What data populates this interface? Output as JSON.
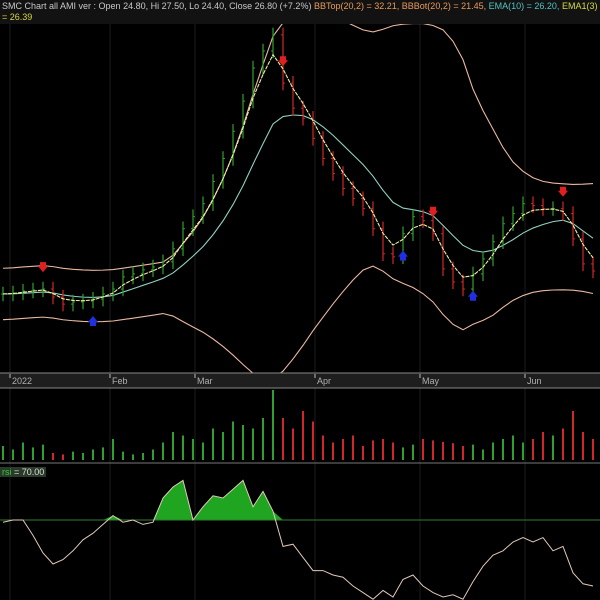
{
  "header": {
    "title": "SMC Chart all AMI ver :",
    "ohlc": "Open 24.80, Hi 27.50, Lo 24.40, Close 26.80 (+7.2%)",
    "bbtop": "BBTop(20,2) = 32.21,",
    "bbbot": "BBBot(20,2) = 21.45,",
    "ema10": "EMA(10) = 26.20,",
    "ema3": "EMA1(3) = 26.39"
  },
  "rsi_label": {
    "name": "rsi",
    "value": "= 70.00"
  },
  "colors": {
    "up": "#2fa02f",
    "down": "#d02828",
    "band": "#e8b8a0",
    "ema10": "#8fd0c0",
    "ema3": "#f0f0a0",
    "fill": "#1fa51f"
  },
  "chart_data": {
    "type": "candlestick",
    "x_tick_labels": [
      "2022",
      "Feb",
      "Mar",
      "Apr",
      "May",
      "Jun"
    ],
    "close": [
      24.93,
      24.99,
      25.11,
      25.18,
      25.24,
      24.74,
      24.3,
      24.43,
      24.49,
      24.61,
      24.93,
      25.24,
      25.99,
      26.18,
      26.43,
      26.61,
      26.93,
      27.74,
      28.99,
      29.74,
      30.55,
      31.93,
      33.36,
      35.05,
      36.93,
      38.99,
      40.05,
      41.05,
      38.05,
      36.49,
      35.86,
      34.61,
      33.36,
      32.43,
      31.49,
      30.86,
      30.24,
      28.99,
      27.43,
      27.24,
      28.68,
      29.74,
      29.49,
      28.68,
      26.49,
      25.68,
      25.24,
      26.18,
      27.11,
      28.18,
      29.3,
      29.93,
      30.55,
      30.43,
      30.24,
      30.24,
      29.93,
      28.36,
      26.8,
      26.36
    ],
    "volume": [
      20,
      15,
      25,
      18,
      22,
      10,
      8,
      12,
      10,
      15,
      18,
      30,
      12,
      8,
      10,
      15,
      25,
      40,
      35,
      30,
      25,
      45,
      40,
      55,
      50,
      45,
      60,
      100,
      60,
      45,
      70,
      55,
      35,
      25,
      30,
      35,
      20,
      28,
      30,
      25,
      18,
      22,
      30,
      28,
      26,
      24,
      20,
      22,
      15,
      25,
      30,
      35,
      25,
      30,
      40,
      35,
      45,
      70,
      40,
      30
    ],
    "rsi": [
      69,
      70,
      70,
      63,
      55,
      50,
      52,
      56,
      61,
      64,
      68,
      72,
      69,
      70,
      68,
      69,
      80,
      85,
      88,
      70,
      76,
      81,
      80,
      84,
      88,
      76,
      83,
      74,
      58,
      59,
      53,
      47,
      47,
      45,
      44,
      40,
      37,
      34,
      38,
      35,
      43,
      45,
      40,
      37,
      35,
      36,
      34,
      42,
      49,
      54,
      56,
      60,
      62,
      60,
      62,
      56,
      58,
      46,
      41,
      40
    ],
    "rsi_threshold": 70,
    "sell_signals_bar_index": [
      4,
      28,
      43,
      56
    ],
    "buy_signals_bar_index": [
      9,
      40,
      47
    ],
    "indicators": [
      "BBTop(20,2)",
      "BBBot(20,2)",
      "EMA(10)",
      "EMA1(3)"
    ],
    "price_range": [
      20.2,
      42.1
    ]
  }
}
